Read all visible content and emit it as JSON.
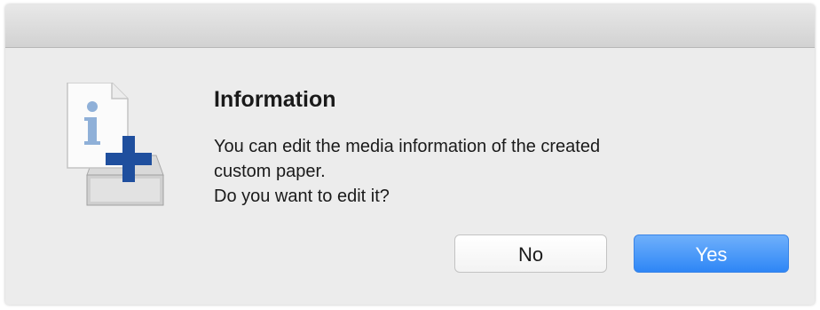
{
  "dialog": {
    "title": "Information",
    "message_lines": [
      "You can edit the media information of the created",
      "custom paper.",
      "Do you want to edit it?"
    ],
    "icon": "info-add-paper-tray-icon",
    "buttons": {
      "no_label": "No",
      "yes_label": "Yes"
    }
  },
  "colors": {
    "dialog_bg": "#ececec",
    "default_button": "#3a8bf7",
    "icon_plus": "#1f4f9e",
    "icon_info": "#8fb0d8"
  }
}
